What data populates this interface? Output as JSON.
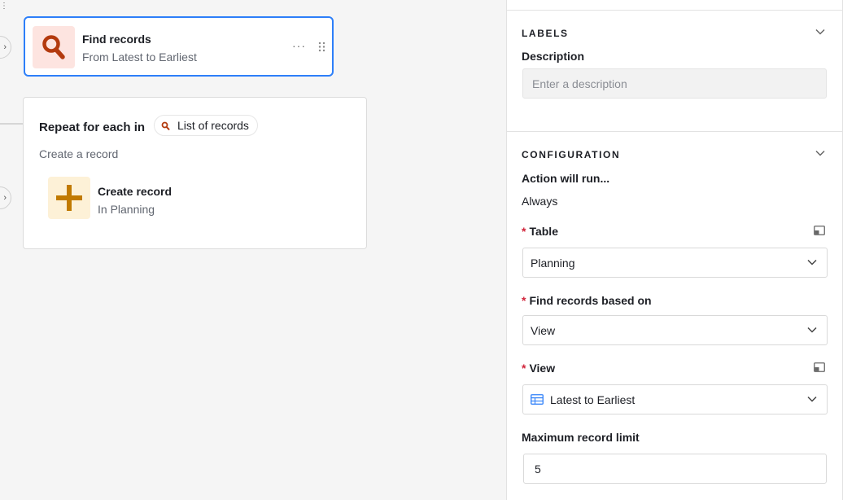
{
  "canvas": {
    "find_card": {
      "title": "Find records",
      "subtitle": "From Latest to Earliest",
      "more_label": "···"
    },
    "repeat_card": {
      "title": "Repeat for each in",
      "token_label": "List of records",
      "subtitle": "Create a record",
      "action": {
        "title": "Create record",
        "subtitle": "In Planning"
      }
    }
  },
  "panel": {
    "labels_section": {
      "heading": "LABELS",
      "description_label": "Description",
      "description_placeholder": "Enter a description",
      "description_value": ""
    },
    "configuration_section": {
      "heading": "CONFIGURATION",
      "run_label": "Action will run...",
      "run_value": "Always",
      "table_label": "Table",
      "table_value": "Planning",
      "find_based_label": "Find records based on",
      "find_based_value": "View",
      "view_label": "View",
      "view_value": "Latest to Earliest",
      "limit_label": "Maximum record limit",
      "limit_value": "5"
    }
  },
  "colors": {
    "accent": "#2d7ff9",
    "required": "#d1243a",
    "find_icon": "#b33a0e",
    "find_tile": "#fde4e0",
    "create_icon": "#c17a00",
    "create_tile": "#fdf1d7"
  },
  "icons": {
    "find": "search-icon",
    "create": "plus-icon",
    "token": "search-icon",
    "view": "grid-view-icon",
    "expand": "expand-panel-icon",
    "chevron": "chevron-down-icon",
    "drag": "drag-handle-icon"
  }
}
